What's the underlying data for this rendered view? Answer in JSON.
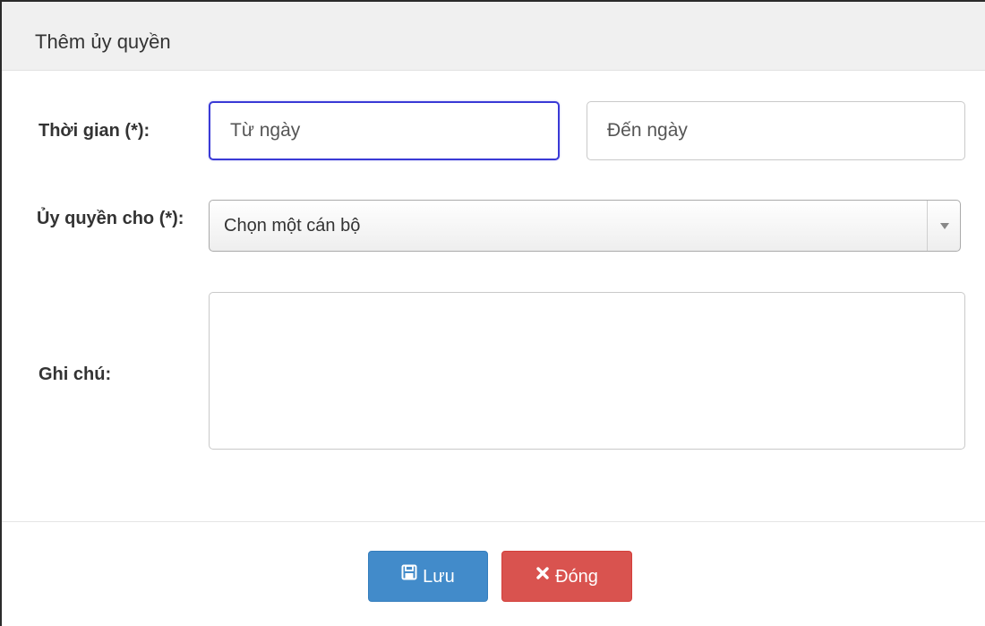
{
  "modal": {
    "title": "Thêm ủy quyền"
  },
  "form": {
    "time": {
      "label": "Thời gian (*):",
      "from_placeholder": "Từ ngày",
      "to_placeholder": "Đến ngày"
    },
    "delegate": {
      "label": "Ủy quyền cho (*):",
      "selected": "Chọn một cán bộ"
    },
    "note": {
      "label": "Ghi chú:"
    }
  },
  "footer": {
    "save_label": "Lưu",
    "save_icon": "floppy-disk-icon",
    "close_label": "Đóng",
    "close_icon": "x-mark-icon"
  },
  "colors": {
    "save_button": "#428bca",
    "close_button": "#d9534f",
    "focus_border": "#3a3ad6"
  }
}
